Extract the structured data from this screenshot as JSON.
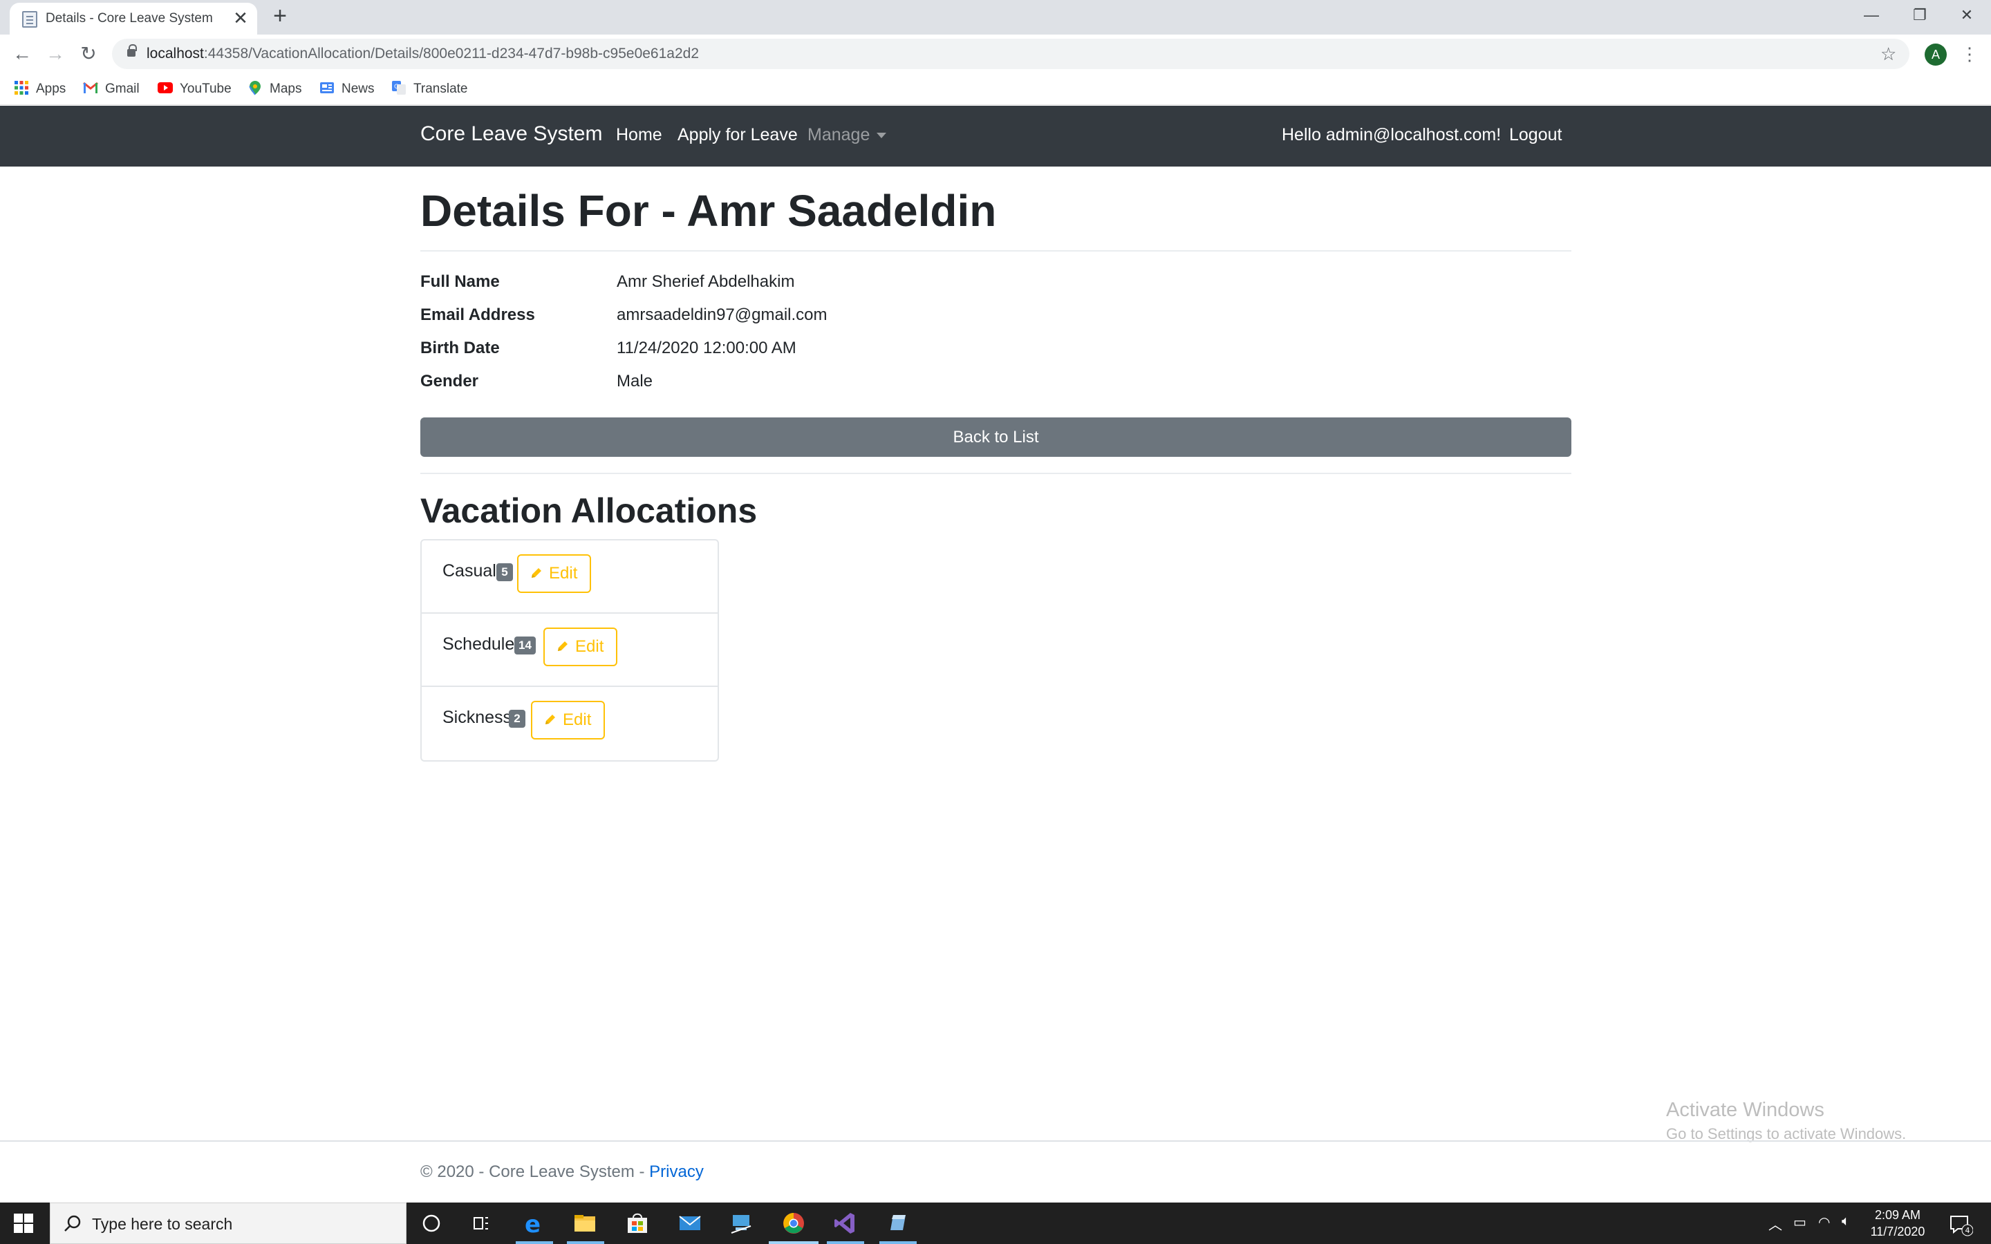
{
  "browser": {
    "tab_title": "Details - Core Leave System",
    "tab_close": "✕",
    "new_tab": "+",
    "url_host": "localhost",
    "url_rest": ":44358/VacationAllocation/Details/800e0211-d234-47d7-b98b-c95e0e61a2d2",
    "profile_initial": "A",
    "bookmarks": [
      "Apps",
      "Gmail",
      "YouTube",
      "Maps",
      "News",
      "Translate"
    ]
  },
  "navbar": {
    "brand": "Core Leave System",
    "links": [
      "Home",
      "Apply for Leave",
      "Manage"
    ],
    "greeting": "Hello admin@localhost.com!",
    "logout": "Logout"
  },
  "page": {
    "title": "Details For - Amr Saadeldin",
    "details": [
      {
        "label": "Full Name",
        "value": "Amr Sherief Abdelhakim"
      },
      {
        "label": "Email Address",
        "value": "amrsaadeldin97@gmail.com"
      },
      {
        "label": "Birth Date",
        "value": "11/24/2020 12:00:00 AM"
      },
      {
        "label": "Gender",
        "value": "Male"
      }
    ],
    "back_button": "Back to List",
    "section_title": "Vacation Allocations",
    "allocations": [
      {
        "name": "Casual",
        "days": "5",
        "edit": "Edit"
      },
      {
        "name": "Schedule",
        "days": "14",
        "edit": "Edit"
      },
      {
        "name": "Sickness",
        "days": "2",
        "edit": "Edit"
      }
    ]
  },
  "watermark": {
    "line1": "Activate Windows",
    "line2": "Go to Settings to activate Windows."
  },
  "footer": {
    "text": "© 2020 - Core Leave System - ",
    "privacy": "Privacy"
  },
  "taskbar": {
    "search_placeholder": "Type here to search",
    "time": "2:09 AM",
    "date": "11/7/2020",
    "notification_count": "4"
  },
  "colors": {
    "navbar_bg": "#343a40",
    "secondary": "#6c757d",
    "warning": "#ffc107",
    "link": "#0366d6"
  }
}
